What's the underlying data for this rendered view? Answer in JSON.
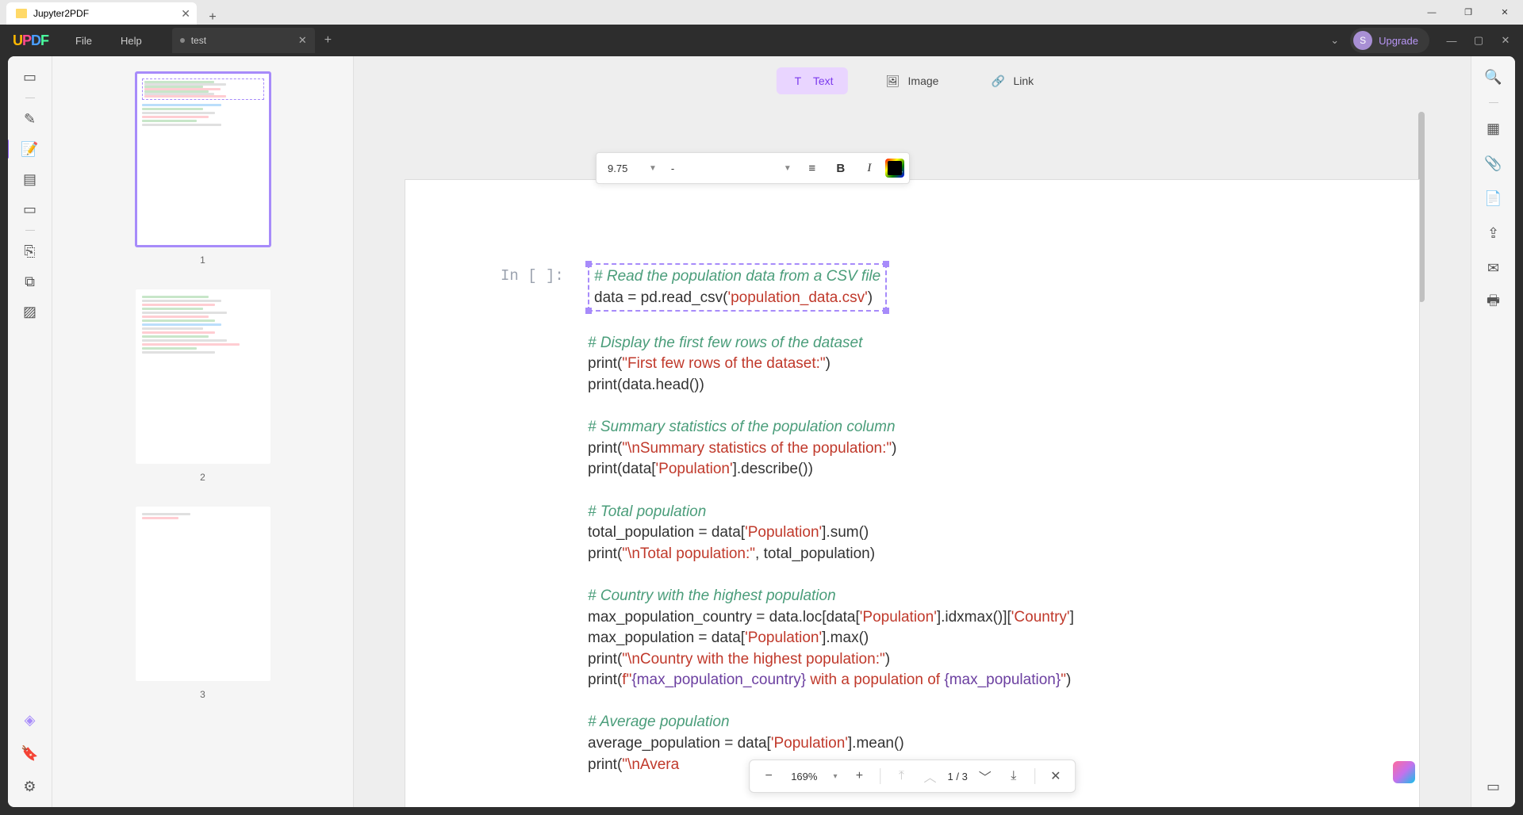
{
  "win": {
    "tab_title": "Jupyter2PDF",
    "minimize": "—",
    "maximize": "❐",
    "close": "✕"
  },
  "app": {
    "menu_file": "File",
    "menu_help": "Help",
    "tab_name": "test",
    "upgrade": "Upgrade",
    "avatar_letter": "S"
  },
  "modes": {
    "text": "Text",
    "image": "Image",
    "link": "Link"
  },
  "text_toolbar": {
    "size": "9.75",
    "font": "-"
  },
  "thumbs": {
    "p1": "1",
    "p2": "2",
    "p3": "3"
  },
  "cell_label": "In [ ]:",
  "code": {
    "l1c": "# Read the population data from a CSV file",
    "l2a": "data = pd.read_csv(",
    "l2b": "'population_data.csv'",
    "l2c": ")",
    "l3c": "# Display the first few rows of the dataset",
    "l4a": "print(",
    "l4b": "\"First few rows of the dataset:\"",
    "l4c": ")",
    "l5": "print(data.head())",
    "l6c": "# Summary statistics of the population column",
    "l7a": "print(",
    "l7b": "\"\\nSummary statistics of the population:\"",
    "l7c": ")",
    "l8a": "print(data[",
    "l8b": "'Population'",
    "l8c": "].describe())",
    "l9c": "# Total population",
    "l10a": "total_population = data[",
    "l10b": "'Population'",
    "l10c": "].sum()",
    "l11a": "print(",
    "l11b": "\"\\nTotal population:\"",
    "l11c": ", total_population)",
    "l12c": "# Country with the highest population",
    "l13a": "max_population_country = data.loc[data[",
    "l13b": "'Population'",
    "l13c": "].idxmax()][",
    "l13d": "'Country'",
    "l13e": "]",
    "l14a": "max_population = data[",
    "l14b": "'Population'",
    "l14c": "].max()",
    "l15a": "print(",
    "l15b": "\"\\nCountry with the highest population:\"",
    "l15c": ")",
    "l16a": "print(",
    "l16b": "f\"",
    "l16c": "{max_population_country}",
    "l16d": " with a population of ",
    "l16e": "{max_population}",
    "l16f": "\"",
    "l16g": ")",
    "l17c": "# Average population",
    "l18a": "average_population = data[",
    "l18b": "'Population'",
    "l18c": "].mean()",
    "l19a": "print(",
    "l19b": "\"\\nAvera"
  },
  "bottom": {
    "zoom": "169%",
    "page_current": "1",
    "page_sep": "/",
    "page_total": "3"
  }
}
